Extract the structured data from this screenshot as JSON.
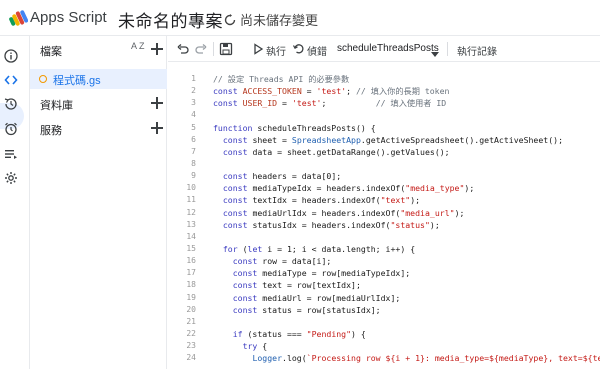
{
  "header": {
    "app_name": "Apps Script",
    "project_title": "未命名的專案",
    "save_status": "尚未儲存變更"
  },
  "files_panel": {
    "title": "檔案",
    "sort_label": "A Z",
    "file": "程式碼.gs",
    "libraries": "資料庫",
    "services": "服務"
  },
  "toolbar": {
    "run": "執行",
    "debug": "偵錯",
    "function": "scheduleThreadsPosts",
    "log": "執行記錄"
  },
  "editor": {
    "line_numbers": [
      "1",
      "2",
      "3",
      "4",
      "5",
      "6",
      "7",
      "8",
      "9",
      "10",
      "11",
      "12",
      "13",
      "14",
      "15",
      "16",
      "17",
      "18",
      "19",
      "20",
      "21",
      "22",
      "23",
      "24"
    ],
    "lines": [
      "// 設定 Threads API 的必要參數",
      "const ACCESS_TOKEN = 'test'; // 填入你的長期 token",
      "const USER_ID = 'test';          // 填入使用者 ID",
      "",
      "function scheduleThreadsPosts() {",
      "  const sheet = SpreadsheetApp.getActiveSpreadsheet().getActiveSheet();",
      "  const data = sheet.getDataRange().getValues();",
      "",
      "  const headers = data[0];",
      "  const mediaTypeIdx = headers.indexOf(\"media_type\");",
      "  const textIdx = headers.indexOf(\"text\");",
      "  const mediaUrlIdx = headers.indexOf(\"media_url\");",
      "  const statusIdx = headers.indexOf(\"status\");",
      "",
      "  for (let i = 1; i < data.length; i++) {",
      "    const row = data[i];",
      "    const mediaType = row[mediaTypeIdx];",
      "    const text = row[textIdx];",
      "    const mediaUrl = row[mediaUrlIdx];",
      "    const status = row[statusIdx];",
      "",
      "    if (status === \"Pending\") {",
      "      try {",
      "        Logger.log(`Processing row ${i + 1}: media_type=${mediaType}, text=${tex"
    ]
  }
}
